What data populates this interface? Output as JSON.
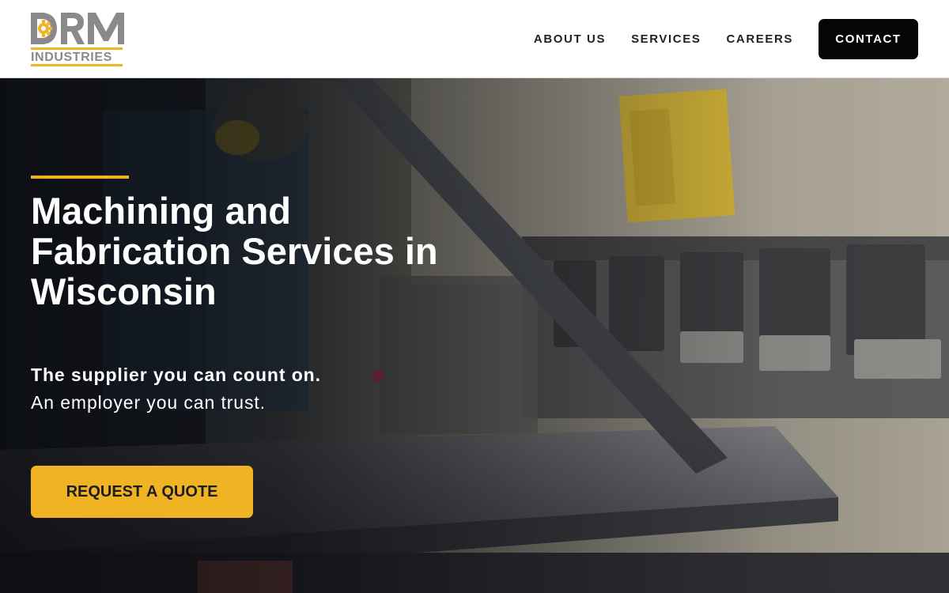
{
  "brand": {
    "logo_mark": "DRM",
    "logo_sub": "INDUSTRIES",
    "accent_color": "#f0b323",
    "logo_gray": "#8a8a8a"
  },
  "nav": {
    "items": [
      {
        "label": "ABOUT US"
      },
      {
        "label": "SERVICES"
      },
      {
        "label": "CAREERS"
      }
    ],
    "cta_label": "CONTACT"
  },
  "hero": {
    "title": "Machining and Fabrication Services in Wisconsin",
    "tagline": "The supplier you can count on.",
    "subtagline": "An employer you can trust.",
    "cta_label": "REQUEST A QUOTE"
  }
}
